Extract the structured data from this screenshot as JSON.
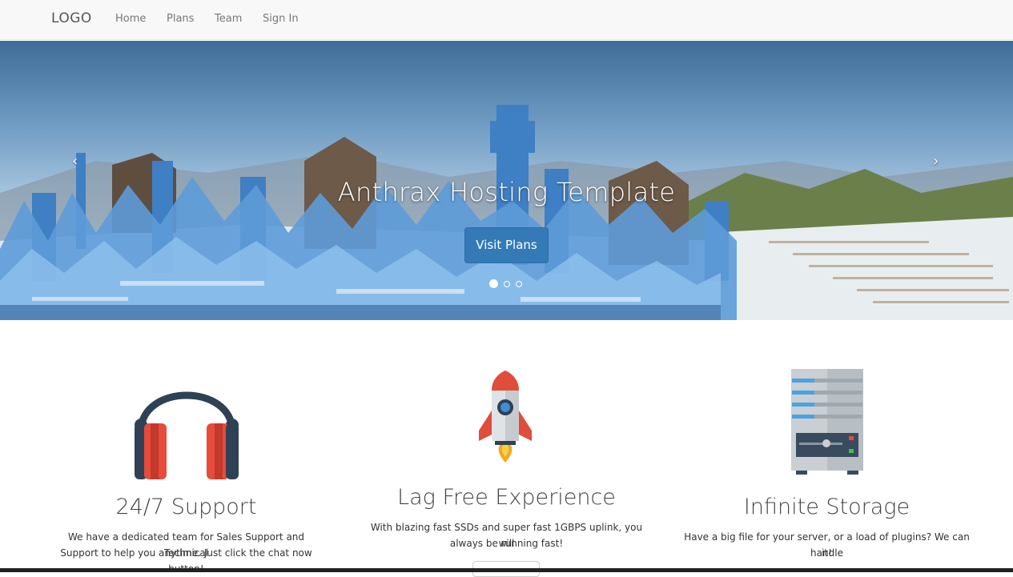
{
  "navbar": {
    "brand": "LOGO",
    "links": [
      "Home",
      "Plans",
      "Team",
      "Sign In"
    ]
  },
  "hero": {
    "title": "Anthrax Hosting Template",
    "button_label": "Visit Plans",
    "prev_arrow": "‹",
    "next_arrow": "›",
    "slides_count": 3,
    "active_slide": 1
  },
  "features": [
    {
      "icon": "headphones-icon",
      "title": "24/7 Support",
      "text_line1": "We have a dedicated team for Sales Support and Technical",
      "text_line2": "Support to help you anytime. Just click the chat now button!"
    },
    {
      "icon": "rocket-icon",
      "title": "Lag Free Experience",
      "text_line1": "With blazing fast SSDs and super fast 1GBPS uplink, you will",
      "text_line2": "always be running fast!"
    },
    {
      "icon": "server-icon",
      "title": "Infinite Storage",
      "text_line1": "Have a big file for your server, or a load of plugins? We can handle",
      "text_line2": "it!"
    }
  ],
  "colors": {
    "primary": "#337ab7",
    "navbar_bg": "#f8f8f8",
    "headphone_band": "#2f4155",
    "headphone_cup": "#e64b3c",
    "rocket_red": "#e14c3b",
    "rocket_body": "#dfe3e6",
    "server_body": "#c9cfd3",
    "server_led_blue": "#4aa3e0"
  }
}
